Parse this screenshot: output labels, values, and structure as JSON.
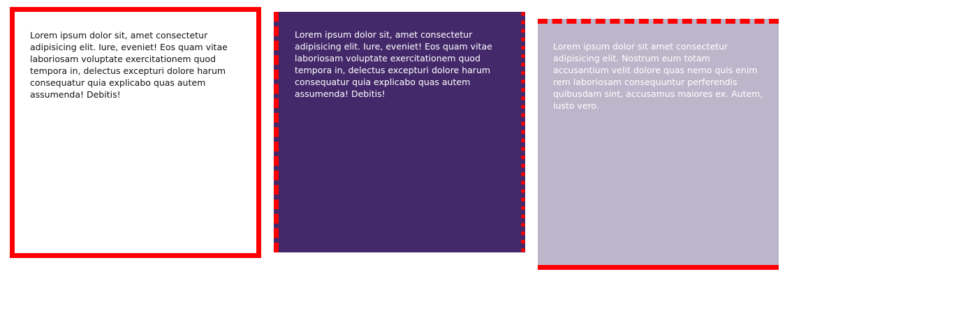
{
  "boxes": [
    {
      "text": "Lorem ipsum dolor sit, amet consectetur adipisicing elit. Iure, eveniet! Eos quam vitae laboriosam voluptate exercitationem quod tempora in, delectus excepturi dolore harum consequatur quia explicabo quas autem assumenda! Debitis!",
      "background": "#ffffff",
      "border_color": "#ff0000",
      "border_style": "solid"
    },
    {
      "text": "Lorem ipsum dolor sit, amet consectetur adipisicing elit. Iure, eveniet! Eos quam vitae laboriosam voluptate exercitationem quod tempora in, delectus excepturi dolore harum consequatur quia explicabo quas autem assumenda! Debitis!",
      "background": "#43296a",
      "border_color": "#ff0000",
      "border_style": "dashed-left dotted-right"
    },
    {
      "text": "Lorem ipsum dolor sit amet consectetur adipisicing elit. Nostrum eum totam accusantium velit dolore quas nemo quis enim rem laboriosam consequuntur perferendis quibusdam sint, accusamus maiores ex. Autem, iusto vero.",
      "background": "#bdb5ca",
      "border_color": "#ff0000",
      "border_style": "dashed-top solid-bottom"
    }
  ]
}
